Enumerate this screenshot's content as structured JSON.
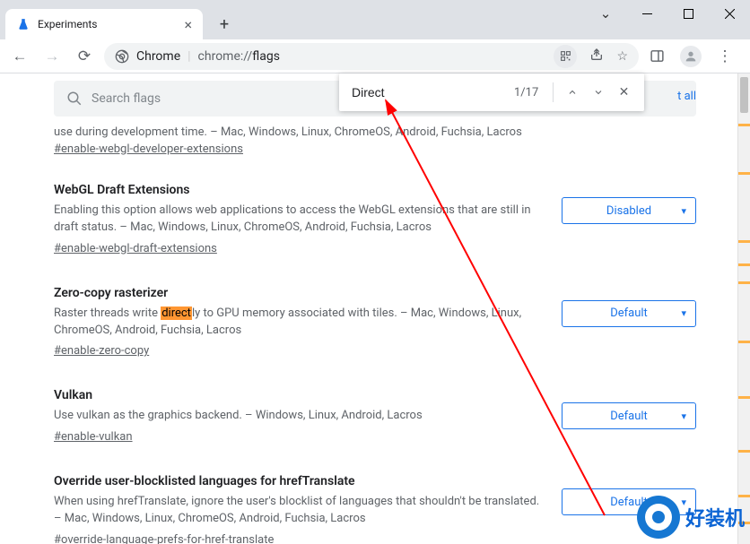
{
  "window": {
    "tab_title": "Experiments",
    "omnibox_label": "Chrome",
    "omnibox_url_prefix": "chrome://",
    "omnibox_url_page": "flags"
  },
  "find": {
    "query": "Direct",
    "count": "1/17"
  },
  "page": {
    "search_placeholder": "Search flags",
    "reset_all": "t all",
    "partial_desc_tail": "use during development time. – Mac, Windows, Linux, ChromeOS, Android, Fuchsia, Lacros",
    "partial_link": "#enable-webgl-developer-extensions"
  },
  "flags": [
    {
      "title": "WebGL Draft Extensions",
      "desc": "Enabling this option allows web applications to access the WebGL extensions that are still in draft status. – Mac, Windows, Linux, ChromeOS, Android, Fuchsia, Lacros",
      "link": "#enable-webgl-draft-extensions",
      "value": "Disabled"
    },
    {
      "title": "Zero-copy rasterizer",
      "desc_pre": "Raster threads write ",
      "desc_hl": "direct",
      "desc_post": "ly to GPU memory associated with tiles. – Mac, Windows, Linux, ChromeOS, Android, Fuchsia, Lacros",
      "link": "#enable-zero-copy",
      "value": "Default"
    },
    {
      "title": "Vulkan",
      "desc": "Use vulkan as the graphics backend. – Windows, Linux, Android, Lacros",
      "link": "#enable-vulkan",
      "value": "Default"
    },
    {
      "title": "Override user-blocklisted languages for hrefTranslate",
      "desc": "When using hrefTranslate, ignore the user's blocklist of languages that shouldn't be translated. – Mac, Windows, Linux, ChromeOS, Android, Fuchsia, Lacros",
      "link": "#override-language-prefs-for-href-translate",
      "value": "Default"
    }
  ],
  "scroll_marks": [
    56,
    110,
    186,
    212,
    232,
    298,
    360,
    420,
    470,
    500
  ],
  "watermark_text": "好装机"
}
